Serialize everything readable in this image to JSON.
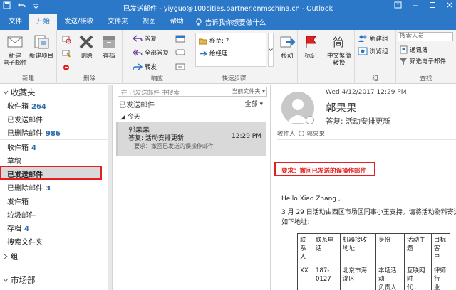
{
  "titlebar": {
    "title": "已发送邮件 - yiyguo@100cities.partner.onmschina.cn - Outlook"
  },
  "tabs": [
    "文件",
    "开始",
    "发送/接收",
    "文件夹",
    "视图",
    "帮助"
  ],
  "active_tab": "开始",
  "tell_me": "告诉我你想要做什么",
  "ribbon": {
    "group_new": {
      "label": "新建",
      "new_email": "新建\n电子邮件",
      "new_items": "新建项目"
    },
    "group_delete": {
      "label": "删除",
      "delete": "删除",
      "archive": "存档"
    },
    "group_respond": {
      "label": "响应",
      "reply": "答复",
      "reply_all": "全部答复",
      "forward": "转发"
    },
    "group_quicksteps": {
      "label": "快速步骤",
      "move_to": "移至: ?",
      "to_manager": "给经理"
    },
    "group_move": {
      "move": "移动"
    },
    "group_tags": {
      "tags": "标记"
    },
    "group_chinese": {
      "label": "中文繁简\n转换"
    },
    "group_groups": {
      "label": "组",
      "new_group": "新建组",
      "browse_groups": "浏览组"
    },
    "group_find": {
      "label": "查找",
      "search_people": "搜索人员",
      "address_book": "通讯簿",
      "filter_email": "筛选电子邮件"
    }
  },
  "folders": {
    "favorites_header": "收藏夹",
    "favorites": [
      {
        "name": "收件箱",
        "count": "264"
      },
      {
        "name": "已发送邮件",
        "count": ""
      },
      {
        "name": "已删除邮件",
        "count": "986"
      }
    ],
    "mailbox": [
      {
        "name": "收件箱",
        "count": "4"
      },
      {
        "name": "草稿",
        "count": ""
      },
      {
        "name": "已发送邮件",
        "count": ""
      },
      {
        "name": "已删除邮件",
        "count": "3"
      },
      {
        "name": "发件箱",
        "count": ""
      },
      {
        "name": "垃圾邮件",
        "count": ""
      },
      {
        "name": "存档",
        "count": "4"
      },
      {
        "name": "搜索文件夹",
        "count": ""
      }
    ],
    "groups_header": "组",
    "market_header": "市场部"
  },
  "msglist": {
    "search_placeholder": "在 已发送邮件 中搜索",
    "search_scope": "当前文件夹",
    "folder_name": "已发送邮件",
    "filter_label": "全部",
    "group_header": "今天",
    "items": [
      {
        "sender": "郭果果",
        "subject": "答复: 活动安排更新",
        "time": "12:29 PM",
        "preview": "要求：撤回已发送的误操作邮件"
      }
    ]
  },
  "reading": {
    "date": "Wed 4/12/2017 12:29 PM",
    "sender": "郭果果",
    "subject": "答复: 活动安排更新",
    "to_label": "收件人",
    "to_name": "郭果果",
    "request": "要求：撤回已发送的误操作邮件",
    "greeting": "Hello Xiao Zhang ,",
    "line1": "3 月 29 日活动由西区市场区同事小王支持。请将活动物料寄送",
    "line2": "如下地址：",
    "table_rows": [
      [
        "联\n系\n人",
        "联系电\n话",
        "机器接收\n地址",
        "身份",
        "活动主题",
        "目标客\n户"
      ],
      [
        "XX",
        "187-\n0127",
        "北京市海\n淀区",
        "本场活动\n负责人",
        "互联网时\n代…",
        "律师行\n业"
      ]
    ]
  },
  "colors": {
    "brand": "#2b78c8",
    "highlight": "#e1201f",
    "count": "#2b6cb0"
  }
}
